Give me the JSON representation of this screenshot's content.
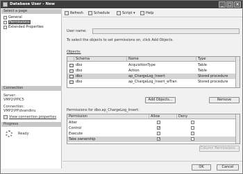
{
  "window": {
    "title": "Database User - New",
    "controls": [
      "_",
      "□",
      "×"
    ]
  },
  "left_pane": {
    "select_page_header": "Select a page",
    "pages": [
      {
        "label": "General",
        "selected": false
      },
      {
        "label": "Permissions",
        "selected": true
      },
      {
        "label": "Extended Properties",
        "selected": false
      }
    ],
    "connection_header": "Connection",
    "server_label": "Server:",
    "server_value": "VMP2\\PPIC5",
    "connection_label": "Connection:",
    "connection_value": "VMP2\\PP\\dvandinu",
    "view_connection_link": "View connection properties",
    "progress_header": "Progress",
    "progress_status": "Ready"
  },
  "toolbar": {
    "refresh": "Refresh",
    "schedule": "Schedule",
    "script": "Script",
    "script_arrow": "▾",
    "help": "Help"
  },
  "user_name_label": "User name:",
  "user_name_value": "",
  "instruction": "To select the objects to set permissions on, click Add Objects.",
  "objects": {
    "label": "Objects:",
    "columns": [
      "",
      "Schema",
      "Name",
      "Type"
    ],
    "rows": [
      {
        "schema": "dbo",
        "name": "AcquisitionType",
        "type": "Table",
        "selected": false
      },
      {
        "schema": "dbo",
        "name": "Action",
        "type": "Table",
        "selected": false
      },
      {
        "schema": "dbo",
        "name": "ap_ChargeLog_Insert",
        "type": "Stored procedure",
        "selected": true
      },
      {
        "schema": "dbo",
        "name": "ap_ChargeLog_Insert_wTran",
        "type": "Stored procedure",
        "selected": false
      }
    ]
  },
  "add_objects_button": "Add Objects...",
  "remove_button": "Remove",
  "permissions": {
    "label": "Permissions for dbo.ap_ChargeLog_Insert:",
    "columns": [
      "Permission",
      "Allow",
      "Deny"
    ],
    "rows": [
      {
        "name": "Alter",
        "allow": false,
        "deny": false,
        "selected": false
      },
      {
        "name": "Control",
        "allow": true,
        "deny": false,
        "selected": false
      },
      {
        "name": "Execute",
        "allow": false,
        "deny": false,
        "selected": false
      },
      {
        "name": "Take ownership",
        "allow": true,
        "deny": false,
        "selected": true
      }
    ]
  },
  "column_permissions_button": "Column Permissions...",
  "footer": {
    "ok": "OK",
    "cancel": "Cancel"
  }
}
